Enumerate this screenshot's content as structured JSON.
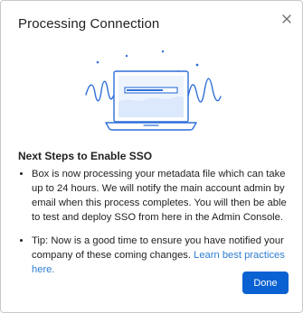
{
  "dialog": {
    "title": "Processing Connection",
    "close_icon": "close-icon",
    "illustration_icon": "laptop-progress-illustration"
  },
  "content": {
    "heading": "Next Steps to Enable SSO",
    "bullet_1": "Box is now processing your metadata file which can take up to 24 hours. We will notify the main account admin by email when this process completes. You will then be able to test and deploy SSO from here in the Admin Console.",
    "bullet_2_text": "Tip: Now is a good time to ensure you have notified your company of these coming changes. ",
    "bullet_2_link": "Learn best practices here."
  },
  "footer": {
    "done_label": "Done"
  },
  "colors": {
    "primary_button": "#0a61d1",
    "link": "#2f7dd1",
    "illustration_stroke": "#2f6fd8",
    "illustration_fill": "#e7f0fc"
  }
}
